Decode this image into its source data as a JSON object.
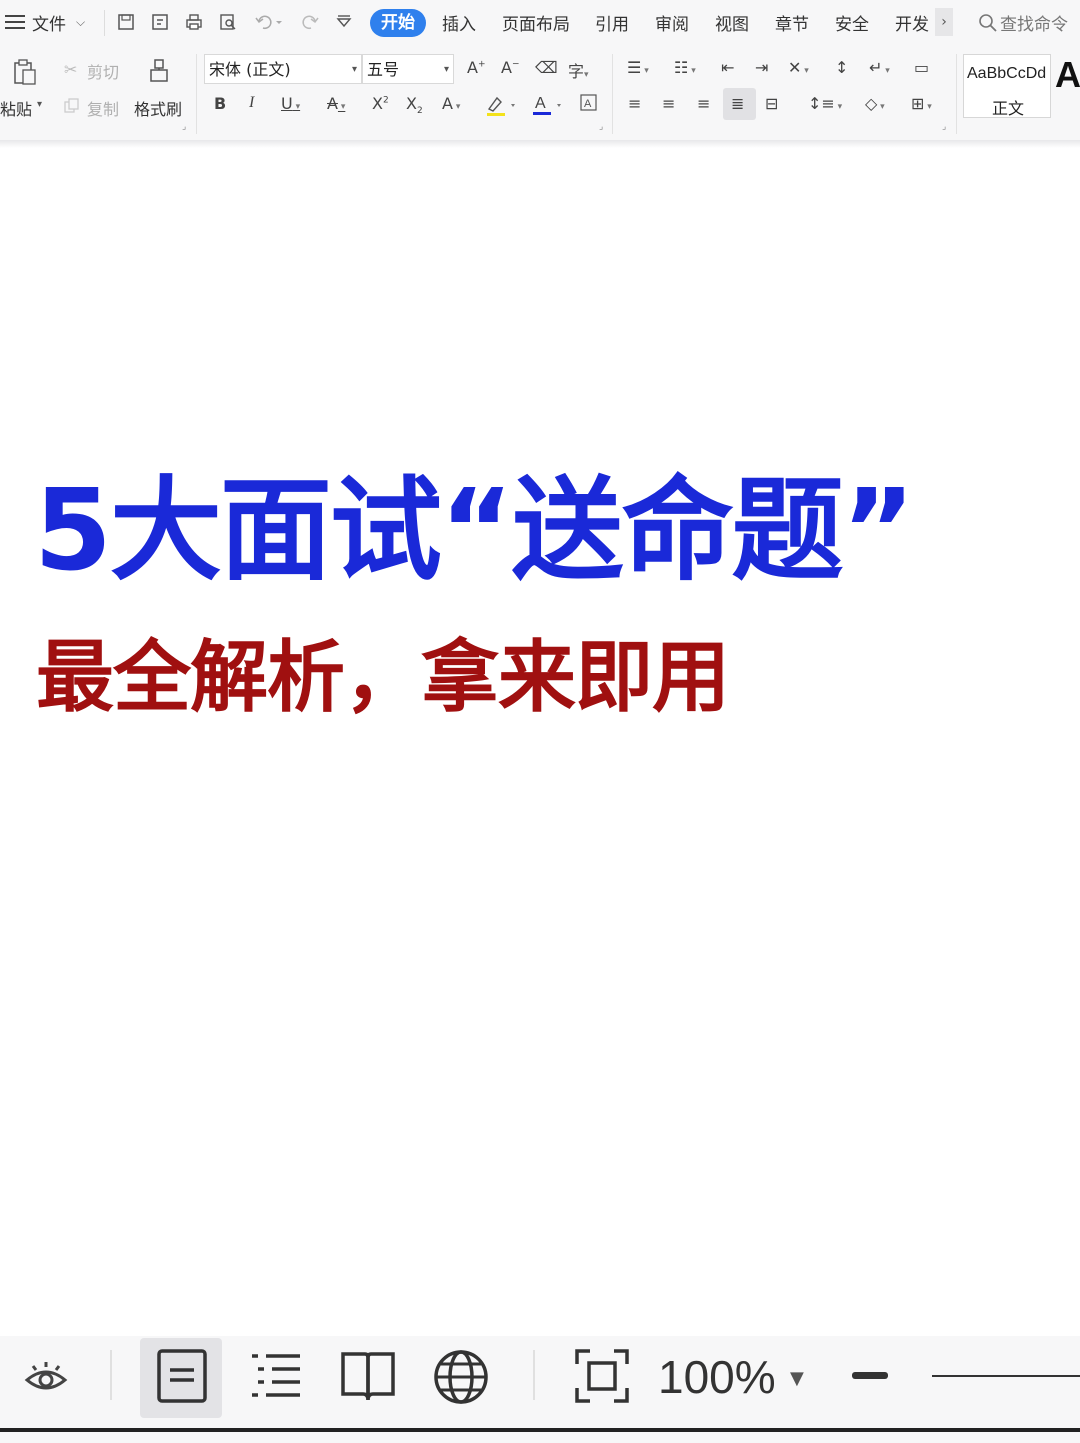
{
  "menubar": {
    "file_label": "文件",
    "tabs": [
      {
        "label": "开始",
        "active": true
      },
      {
        "label": "插入"
      },
      {
        "label": "页面布局"
      },
      {
        "label": "引用"
      },
      {
        "label": "审阅"
      },
      {
        "label": "视图"
      },
      {
        "label": "章节"
      },
      {
        "label": "安全"
      },
      {
        "label": "开发"
      }
    ],
    "search_placeholder": "查找命令"
  },
  "ribbon": {
    "paste_label": "粘贴",
    "cut_label": "剪切",
    "copy_label": "复制",
    "format_painter_label": "格式刷",
    "font_name": "宋体 (正文)",
    "font_size": "五号",
    "style_preview": "AaBbCcDd",
    "style_name": "正文",
    "style_next_preview": "A"
  },
  "document": {
    "title": "5大面试“送命题”",
    "subtitle": "最全解析，拿来即用",
    "title_color": "#1a29d8",
    "subtitle_color": "#a01010"
  },
  "statusbar": {
    "zoom": "100%"
  },
  "colors": {
    "accent": "#2f80ed"
  }
}
